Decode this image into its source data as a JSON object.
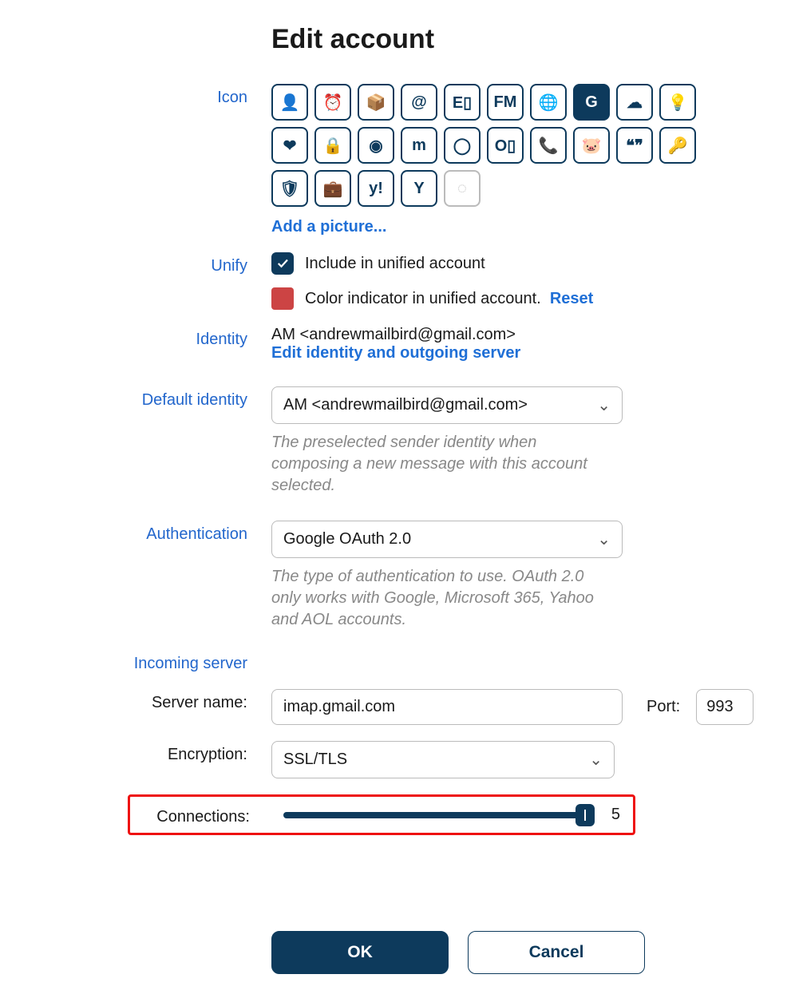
{
  "title": "Edit account",
  "labels": {
    "icon": "Icon",
    "unify": "Unify",
    "identity": "Identity",
    "default_identity": "Default identity",
    "authentication": "Authentication",
    "incoming_server": "Incoming server",
    "server_name": "Server name:",
    "encryption": "Encryption:",
    "connections": "Connections:",
    "port": "Port:"
  },
  "add_picture": "Add a picture...",
  "unify_checkbox": "Include in unified account",
  "color_indicator": "Color indicator in unified account.",
  "color_value": "#c44",
  "reset": "Reset",
  "identity_text": "AM <andrewmailbird@gmail.com>",
  "edit_identity": "Edit identity and outgoing server",
  "default_identity_value": "AM <andrewmailbird@gmail.com>",
  "default_identity_desc": "The preselected sender identity when composing a new message with this account selected.",
  "auth_value": "Google OAuth 2.0",
  "auth_desc": "The type of authentication to use. OAuth 2.0 only works with Google, Microsoft 365, Yahoo and AOL accounts.",
  "server_name_value": "imap.gmail.com",
  "port_value": "993",
  "encryption_value": "SSL/TLS",
  "connections_value": "5",
  "icons": [
    {
      "name": "person-icon",
      "selected": false
    },
    {
      "name": "clock-icon",
      "selected": false
    },
    {
      "name": "box-icon",
      "selected": false
    },
    {
      "name": "at-icon",
      "selected": false
    },
    {
      "name": "exchange-icon",
      "selected": false
    },
    {
      "name": "fastmail-icon",
      "selected": false
    },
    {
      "name": "globe-icon",
      "selected": false
    },
    {
      "name": "google-icon",
      "selected": true
    },
    {
      "name": "cloud-icon",
      "selected": false
    },
    {
      "name": "bulb-icon",
      "selected": false
    },
    {
      "name": "heart-icon",
      "selected": false
    },
    {
      "name": "lock-icon",
      "selected": false
    },
    {
      "name": "swirl-icon",
      "selected": false
    },
    {
      "name": "mastodon-icon",
      "selected": false
    },
    {
      "name": "circle-icon",
      "selected": false
    },
    {
      "name": "outlook-icon",
      "selected": false
    },
    {
      "name": "phone-icon",
      "selected": false
    },
    {
      "name": "piggy-icon",
      "selected": false
    },
    {
      "name": "quotes-icon",
      "selected": false
    },
    {
      "name": "key-icon",
      "selected": false
    },
    {
      "name": "shield-icon",
      "selected": false
    },
    {
      "name": "briefcase-icon",
      "selected": false
    },
    {
      "name": "yahoo-icon",
      "selected": false
    },
    {
      "name": "gamma-icon",
      "selected": false
    },
    {
      "name": "custom-icon",
      "selected": false,
      "dim": true
    }
  ],
  "buttons": {
    "ok": "OK",
    "cancel": "Cancel"
  }
}
